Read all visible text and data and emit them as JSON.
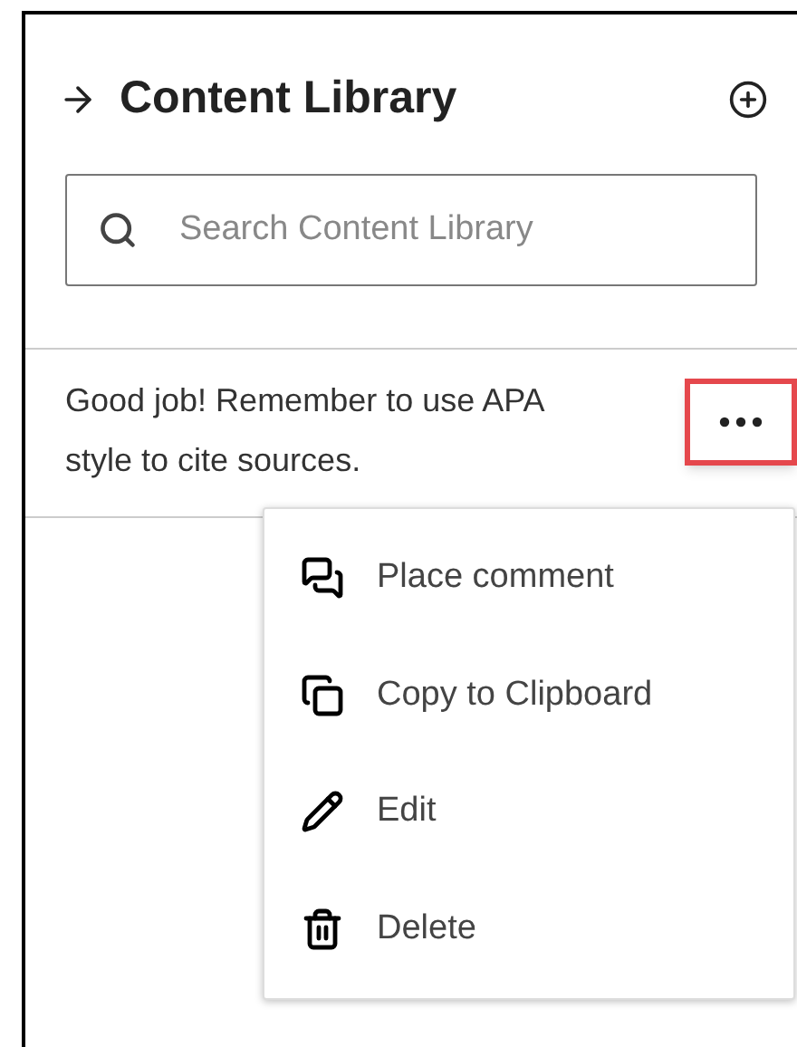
{
  "panel": {
    "title": "Content Library"
  },
  "search": {
    "placeholder": "Search Content Library"
  },
  "items": [
    {
      "text": "Good job! Remember to use APA style to cite sources.",
      "menu_open": true
    }
  ],
  "menu": [
    {
      "kind": "comment",
      "label": "Place comment"
    },
    {
      "kind": "copy",
      "label": "Copy to Clipboard"
    },
    {
      "kind": "edit",
      "label": "Edit"
    },
    {
      "kind": "delete",
      "label": "Delete"
    }
  ]
}
